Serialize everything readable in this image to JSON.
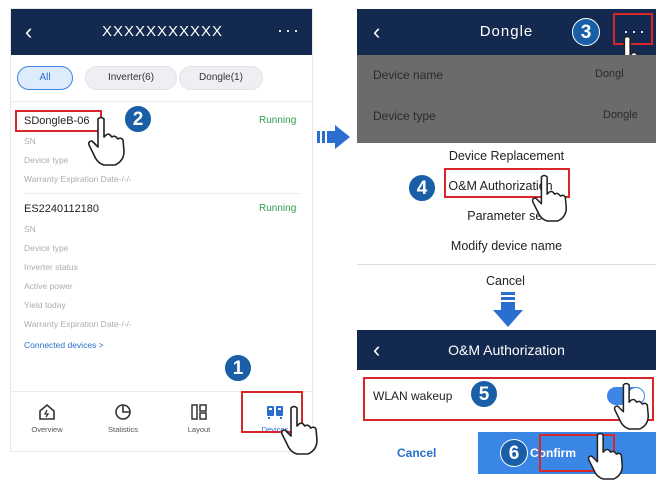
{
  "left_screen": {
    "title": "XXXXXXXXXXX",
    "filters": [
      "All",
      "Inverter(6)",
      "Dongle(1)"
    ],
    "devices": [
      {
        "name": "SDongleB-06",
        "status": "Running",
        "fields": [
          "SN",
          "Device type",
          "Warranty Expiration Date-/-/-"
        ]
      },
      {
        "name": "ES2240112180",
        "status": "Running",
        "fields": [
          "SN",
          "Device type",
          "Inverter status",
          "Active power",
          "Yield today",
          "Warranty Expiration Date-/-/-"
        ],
        "link": "Connected devices >"
      }
    ],
    "nav": [
      "Overview",
      "Statistics",
      "Layout",
      "Devices"
    ]
  },
  "right_screen": {
    "title": "Dongle",
    "rows": [
      {
        "label": "Device name",
        "value": "Dongl"
      },
      {
        "label": "Device type",
        "value": "Dongle"
      }
    ],
    "menu": [
      "Device Replacement",
      "O&M Authorization",
      "Parameter set",
      "Modify device name"
    ],
    "cancel": "Cancel"
  },
  "oam_screen": {
    "title": "O&M Authorization",
    "wlan_label": "WLAN wakeup",
    "wlan_on": true,
    "cancel": "Cancel",
    "confirm": "Confirm"
  },
  "steps": [
    "1",
    "2",
    "3",
    "4",
    "5",
    "6"
  ],
  "colors": {
    "header": "#14294f",
    "accent": "#3a86e4",
    "status_green": "#2e9d4a",
    "step_badge": "#1a5ea8",
    "highlight": "#d8262b"
  }
}
